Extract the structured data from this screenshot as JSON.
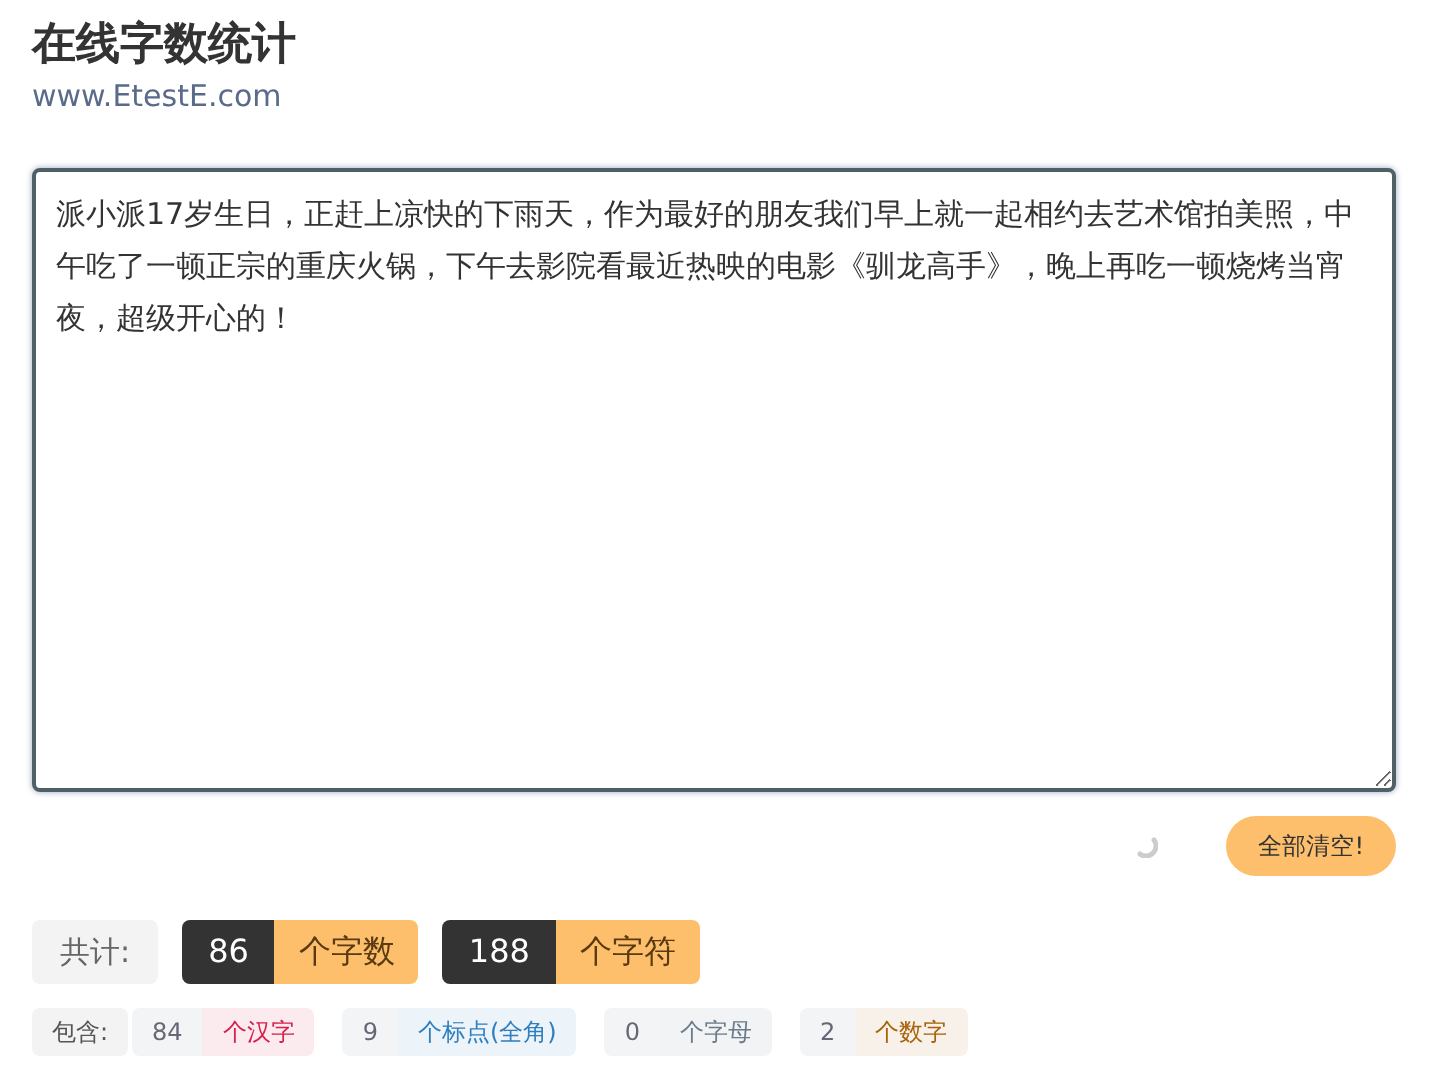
{
  "header": {
    "title": "在线字数统计",
    "subtitle": "www.EtestE.com"
  },
  "editor": {
    "value": "派小派17岁生日，正赶上凉快的下雨天，作为最好的朋友我们早上就一起相约去艺术馆拍美照，中午吃了一顿正宗的重庆火锅，下午去影院看最近热映的电影《驯龙高手》，晚上再吃一顿烧烤当宵夜，超级开心的！"
  },
  "clear_button": "全部清空!",
  "totals": {
    "label": "共计:",
    "items": [
      {
        "value": "86",
        "unit": "个字数"
      },
      {
        "value": "188",
        "unit": "个字符"
      }
    ]
  },
  "breakdown": {
    "label": "包含:",
    "items": [
      {
        "value": "84",
        "unit": "个汉字",
        "color": "#d6204e"
      },
      {
        "value": "9",
        "unit": "个标点(全角)",
        "color": "#2f7fc0"
      },
      {
        "value": "0",
        "unit": "个字母",
        "color": "#6b7b8b"
      },
      {
        "value": "2",
        "unit": "个数字",
        "color": "#a8620a"
      }
    ]
  }
}
